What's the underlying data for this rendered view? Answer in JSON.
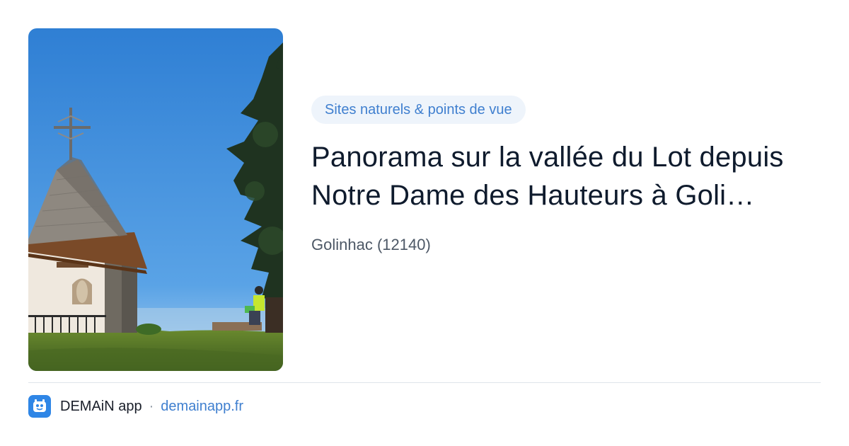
{
  "card": {
    "image_subject": "chapel-hilltop-photo",
    "category": "Sites naturels & points de vue",
    "title": "Panorama sur la vallée du Lot depuis Notre Dame des Hauteurs à Goli…",
    "location": "Golinhac (12140)"
  },
  "footer": {
    "app_icon": "app-logo-icon",
    "app_name": "DEMAiN app",
    "separator": "·",
    "domain": "demainapp.fr"
  },
  "colors": {
    "accent": "#3f7fcf",
    "chip_bg": "#eef4fb",
    "title": "#0f1b2d",
    "muted": "#4d5866",
    "app_icon_bg": "#2f86e6"
  }
}
